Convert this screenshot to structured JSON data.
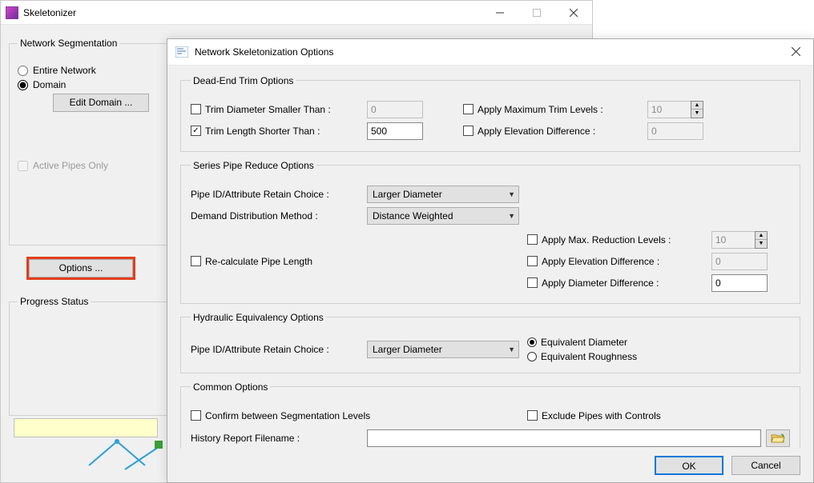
{
  "main": {
    "title": "Skeletonizer",
    "segmentation": {
      "legend": "Network Segmentation",
      "entire": "Entire Network",
      "domain": "Domain",
      "selected": "domain",
      "edit_domain": "Edit Domain ...",
      "active_only": "Active Pipes Only"
    },
    "options_btn": "Options ...",
    "progress": {
      "legend": "Progress Status"
    }
  },
  "dialog": {
    "title": "Network Skeletonization Options",
    "deadend": {
      "legend": "Dead-End Trim Options",
      "trim_diam": {
        "label": "Trim Diameter Smaller Than :",
        "checked": false,
        "value": "0"
      },
      "trim_len": {
        "label": "Trim Length Shorter Than :",
        "checked": true,
        "value": "500"
      },
      "max_levels": {
        "label": "Apply Maximum Trim Levels :",
        "checked": false,
        "value": "10"
      },
      "elev_diff": {
        "label": "Apply Elevation Difference :",
        "checked": false,
        "value": "0"
      }
    },
    "series": {
      "legend": "Series Pipe Reduce Options",
      "retain_lbl": "Pipe ID/Attribute Retain Choice :",
      "retain_val": "Larger Diameter",
      "demand_lbl": "Demand Distribution Method :",
      "demand_val": "Distance Weighted",
      "recalc": {
        "label": "Re-calculate Pipe Length",
        "checked": false
      },
      "max_levels": {
        "label": "Apply Max. Reduction Levels :",
        "checked": false,
        "value": "10"
      },
      "elev_diff": {
        "label": "Apply Elevation Difference :",
        "checked": false,
        "value": "0"
      },
      "diam_diff": {
        "label": "Apply Diameter Difference :",
        "checked": false,
        "value": "0"
      }
    },
    "hydraulic": {
      "legend": "Hydraulic Equivalency Options",
      "retain_lbl": "Pipe ID/Attribute Retain Choice :",
      "retain_val": "Larger Diameter",
      "eq_diam": "Equivalent Diameter",
      "eq_rough": "Equivalent Roughness",
      "selected": "diameter"
    },
    "common": {
      "legend": "Common Options",
      "confirm": {
        "label": "Confirm between Segmentation Levels",
        "checked": false
      },
      "exclude": {
        "label": "Exclude Pipes with Controls",
        "checked": false
      },
      "history_lbl": "History Report Filename :",
      "history_val": ""
    },
    "footer": {
      "ok": "OK",
      "cancel": "Cancel"
    }
  }
}
